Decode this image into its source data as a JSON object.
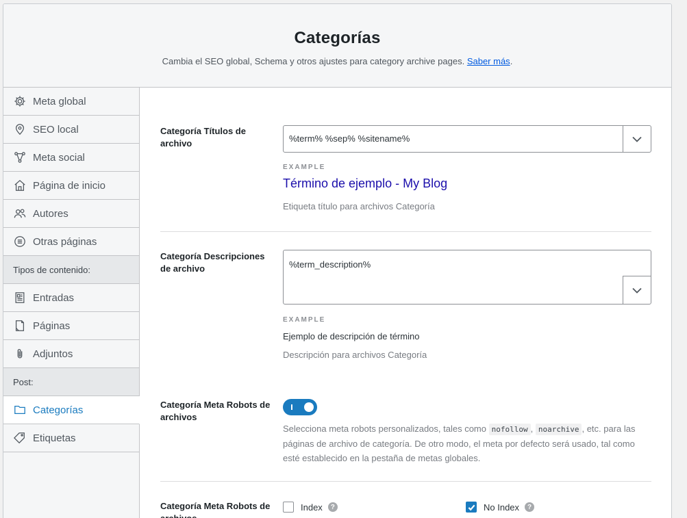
{
  "header": {
    "title": "Categorías",
    "subtitle": "Cambia el SEO global, Schema y otros ajustes para category archive pages.",
    "link": "Saber más",
    "link_suffix": "."
  },
  "sidebar": {
    "items": [
      {
        "label": "Meta global",
        "icon": "gear-icon"
      },
      {
        "label": "SEO local",
        "icon": "location-pin-icon"
      },
      {
        "label": "Meta social",
        "icon": "social-nodes-icon"
      },
      {
        "label": "Página de inicio",
        "icon": "home-icon"
      },
      {
        "label": "Autores",
        "icon": "users-icon"
      },
      {
        "label": "Otras páginas",
        "icon": "list-circle-icon"
      }
    ],
    "section_content": "Tipos de contenido:",
    "content_items": [
      {
        "label": "Entradas",
        "icon": "document-icon"
      },
      {
        "label": "Páginas",
        "icon": "page-icon"
      },
      {
        "label": "Adjuntos",
        "icon": "paperclip-icon"
      }
    ],
    "section_post": "Post:",
    "post_items": [
      {
        "label": "Categorías",
        "icon": "folder-icon",
        "active": true
      },
      {
        "label": "Etiquetas",
        "icon": "tag-icon"
      }
    ]
  },
  "main": {
    "title_row": {
      "label": "Categoría Títulos de archivo",
      "value": "%term% %sep% %sitename%",
      "example_label": "EXAMPLE",
      "example": "Término de ejemplo - My Blog",
      "help": "Etiqueta título para archivos Categoría"
    },
    "desc_row": {
      "label": "Categoría Descripciones de archivo",
      "value": "%term_description%",
      "example_label": "EXAMPLE",
      "example": "Ejemplo de descripción de término",
      "help": "Descripción para archivos Categoría"
    },
    "robots_row": {
      "label": "Categoría Meta Robots de archivos",
      "toggle_on": true,
      "help_pre": "Selecciona meta robots personalizados, tales como",
      "code1": "nofollow",
      "sep": ",",
      "code2": "noarchive",
      "help_post": ", etc. para las páginas de archivo de categoría. De otro modo, el meta por defecto será usado, tal como esté establecido en la pestaña de metas globales."
    },
    "robots_row2": {
      "label": "Categoría Meta Robots de archivos",
      "index_label": "Index",
      "index_checked": false,
      "noindex_label": "No Index",
      "noindex_checked": true,
      "help_glyph": "?"
    }
  }
}
